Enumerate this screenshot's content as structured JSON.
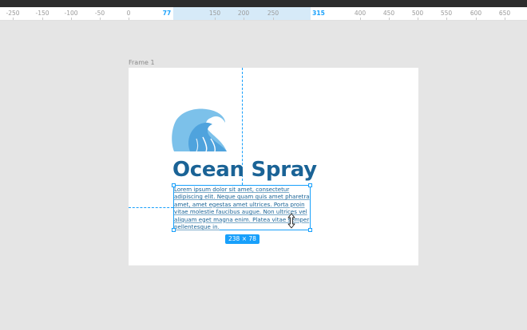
{
  "ruler": {
    "ticks": [
      "-250",
      "-150",
      "-100",
      "-50",
      "0",
      "77",
      "150",
      "200",
      "250",
      "315",
      "400",
      "450",
      "500",
      "550",
      "600",
      "650"
    ],
    "selection_start": "77",
    "selection_end": "315"
  },
  "frame": {
    "label": "Frame 1"
  },
  "canvas": {
    "title": "Ocean Spray",
    "body": "Lorem ipsum dolor sit amet, consectetur adipiscing elit. Neque quam quis amet pharetra amet, amet egestas amet ultrices. Porta proin vitae molestie faucibus augue. Non ultrices vel aliquam eget magna enim. Platea vitae semper pellentesque in.",
    "size_badge": "238 × 78"
  },
  "colors": {
    "accent": "#18a0fb",
    "brand": "#1a6396",
    "logo_light": "#7cc1ea",
    "logo_mid": "#4fa3dd"
  },
  "icons": {
    "logo": "wave-logo-icon",
    "cursor": "resize-vertical-cursor-icon"
  }
}
